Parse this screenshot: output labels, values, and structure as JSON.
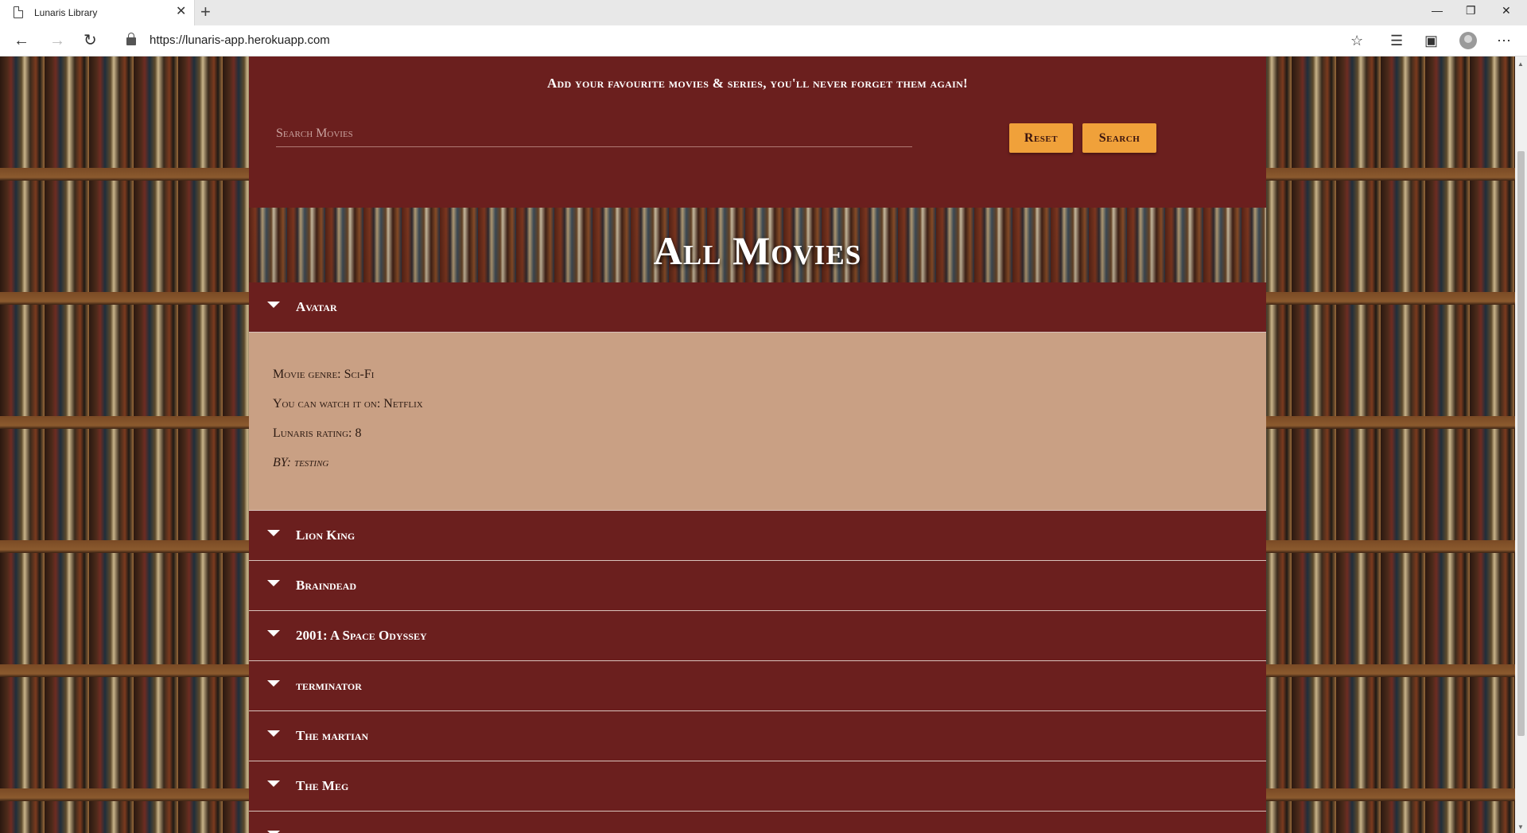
{
  "browser": {
    "tab_title": "Lunaris Library",
    "url": "https://lunaris-app.herokuapp.com",
    "window_controls": [
      "—",
      "❐",
      "✕"
    ]
  },
  "search": {
    "tagline": "Add your favourite movies & series, you'll never forget them again!",
    "placeholder": "Search Movies",
    "value": "",
    "reset_label": "Reset",
    "search_label": "Search"
  },
  "banner": {
    "title": "All Movies"
  },
  "movies": [
    {
      "title": "Avatar",
      "expanded": true,
      "genre_line": "Movie genre: Sci-Fi",
      "watch_line": "You can watch it on: Netflix",
      "rating_line": "Lunaris rating: 8",
      "by_line": "BY: testing"
    },
    {
      "title": "Lion King"
    },
    {
      "title": "Braindead"
    },
    {
      "title": "2001: A Space Odyssey"
    },
    {
      "title": "terminator"
    },
    {
      "title": "The martian"
    },
    {
      "title": "The Meg"
    },
    {
      "title": ""
    }
  ]
}
